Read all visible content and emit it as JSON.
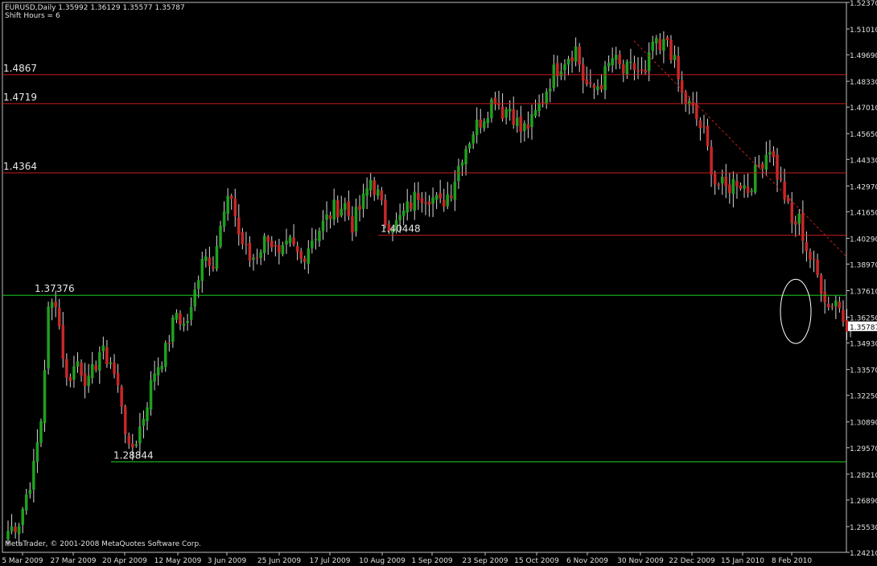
{
  "header": {
    "symbol_line": "EURUSD,Daily  1.35992 1.36129 1.35577 1.35787",
    "shift_line": "Shift Hours = 6"
  },
  "footer": {
    "copyright": "MetaTrader, © 2001-2008 MetaQuotes Software Corp."
  },
  "colors": {
    "background": "#000000",
    "bull": "#20a020",
    "bear": "#c82828",
    "resistance": "#c81e1e",
    "support": "#1ec81e",
    "trendline": "#c81e1e",
    "axis_text": "#e0e0e0",
    "current_price_bg": "#ffffff"
  },
  "chart_data": {
    "type": "candlestick",
    "symbol": "EURUSD",
    "timeframe": "Daily",
    "ylim": [
      1.2421,
      1.5237
    ],
    "y_ticks": [
      "1.52370",
      "1.51010",
      "1.49690",
      "1.48330",
      "1.47010",
      "1.45650",
      "1.44330",
      "1.42970",
      "1.41650",
      "1.40290",
      "1.38970",
      "1.37610",
      "1.36250",
      "1.34930",
      "1.33570",
      "1.32250",
      "1.30890",
      "1.29570",
      "1.28210",
      "1.26890",
      "1.25530",
      "1.24210"
    ],
    "x_ticks": [
      "5 Mar 2009",
      "27 Mar 2009",
      "20 Apr 2009",
      "12 May 2009",
      "3 Jun 2009",
      "25 Jun 2009",
      "17 Jul 2009",
      "10 Aug 2009",
      "1 Sep 2009",
      "23 Sep 2009",
      "15 Oct 2009",
      "6 Nov 2009",
      "30 Nov 2009",
      "22 Dec 2009",
      "15 Jan 2010",
      "8 Feb 2010"
    ],
    "current_price": "1.35787",
    "levels": [
      {
        "label": "1.4867",
        "price": 1.4867,
        "color": "red",
        "from": "5 Mar 2009"
      },
      {
        "label": "1.4719",
        "price": 1.4719,
        "color": "red",
        "from": "5 Mar 2009"
      },
      {
        "label": "1.4364",
        "price": 1.4364,
        "color": "red",
        "from": "5 Mar 2009"
      },
      {
        "label": "1.40448",
        "price": 1.40448,
        "color": "red",
        "from": "10 Aug 2009"
      },
      {
        "label": "1.37376",
        "price": 1.37376,
        "color": "green",
        "from": "5 Mar 2009"
      },
      {
        "label": "1.28844",
        "price": 1.28844,
        "color": "green",
        "from": "20 Apr 2009"
      }
    ],
    "trendline": {
      "from_date": "30 Nov 2009",
      "from_price": 1.504,
      "to_price": 1.3935,
      "style": "dashed"
    },
    "highlight": {
      "type": "ellipse",
      "date": "8 Feb 2010",
      "price_range": [
        1.354,
        1.377
      ]
    },
    "anchors": [
      {
        "i": 0,
        "p": 1.253
      },
      {
        "i": 3,
        "p": 1.258
      },
      {
        "i": 7,
        "p": 1.285
      },
      {
        "i": 9,
        "p": 1.31
      },
      {
        "i": 11,
        "p": 1.365
      },
      {
        "i": 13,
        "p": 1.372
      },
      {
        "i": 16,
        "p": 1.33
      },
      {
        "i": 19,
        "p": 1.34
      },
      {
        "i": 22,
        "p": 1.328
      },
      {
        "i": 25,
        "p": 1.345
      },
      {
        "i": 28,
        "p": 1.34
      },
      {
        "i": 31,
        "p": 1.319
      },
      {
        "i": 33,
        "p": 1.293
      },
      {
        "i": 35,
        "p": 1.3
      },
      {
        "i": 37,
        "p": 1.312
      },
      {
        "i": 40,
        "p": 1.335
      },
      {
        "i": 43,
        "p": 1.345
      },
      {
        "i": 46,
        "p": 1.365
      },
      {
        "i": 48,
        "p": 1.358
      },
      {
        "i": 50,
        "p": 1.365
      },
      {
        "i": 53,
        "p": 1.395
      },
      {
        "i": 56,
        "p": 1.392
      },
      {
        "i": 59,
        "p": 1.415
      },
      {
        "i": 61,
        "p": 1.425
      },
      {
        "i": 63,
        "p": 1.405
      },
      {
        "i": 66,
        "p": 1.392
      },
      {
        "i": 68,
        "p": 1.395
      },
      {
        "i": 71,
        "p": 1.405
      },
      {
        "i": 74,
        "p": 1.392
      },
      {
        "i": 77,
        "p": 1.4
      },
      {
        "i": 80,
        "p": 1.392
      },
      {
        "i": 83,
        "p": 1.403
      },
      {
        "i": 86,
        "p": 1.41
      },
      {
        "i": 89,
        "p": 1.418
      },
      {
        "i": 92,
        "p": 1.42
      },
      {
        "i": 94,
        "p": 1.41
      },
      {
        "i": 97,
        "p": 1.422
      },
      {
        "i": 99,
        "p": 1.433
      },
      {
        "i": 101,
        "p": 1.425
      },
      {
        "i": 103,
        "p": 1.412
      },
      {
        "i": 106,
        "p": 1.41
      },
      {
        "i": 109,
        "p": 1.418
      },
      {
        "i": 112,
        "p": 1.426
      },
      {
        "i": 115,
        "p": 1.425
      },
      {
        "i": 118,
        "p": 1.42
      },
      {
        "i": 121,
        "p": 1.428
      },
      {
        "i": 124,
        "p": 1.446
      },
      {
        "i": 127,
        "p": 1.458
      },
      {
        "i": 130,
        "p": 1.466
      },
      {
        "i": 133,
        "p": 1.476
      },
      {
        "i": 135,
        "p": 1.468
      },
      {
        "i": 137,
        "p": 1.47
      },
      {
        "i": 140,
        "p": 1.458
      },
      {
        "i": 143,
        "p": 1.462
      },
      {
        "i": 146,
        "p": 1.475
      },
      {
        "i": 149,
        "p": 1.488
      },
      {
        "i": 152,
        "p": 1.495
      },
      {
        "i": 155,
        "p": 1.5
      },
      {
        "i": 157,
        "p": 1.485
      },
      {
        "i": 159,
        "p": 1.478
      },
      {
        "i": 162,
        "p": 1.483
      },
      {
        "i": 165,
        "p": 1.495
      },
      {
        "i": 168,
        "p": 1.488
      },
      {
        "i": 171,
        "p": 1.49
      },
      {
        "i": 174,
        "p": 1.485
      },
      {
        "i": 176,
        "p": 1.503
      },
      {
        "i": 178,
        "p": 1.498
      },
      {
        "i": 180,
        "p": 1.505
      },
      {
        "i": 182,
        "p": 1.492
      },
      {
        "i": 184,
        "p": 1.476
      },
      {
        "i": 187,
        "p": 1.468
      },
      {
        "i": 190,
        "p": 1.456
      },
      {
        "i": 193,
        "p": 1.432
      },
      {
        "i": 196,
        "p": 1.428
      },
      {
        "i": 199,
        "p": 1.433
      },
      {
        "i": 202,
        "p": 1.428
      },
      {
        "i": 205,
        "p": 1.44
      },
      {
        "i": 208,
        "p": 1.45
      },
      {
        "i": 210,
        "p": 1.436
      },
      {
        "i": 212,
        "p": 1.425
      },
      {
        "i": 214,
        "p": 1.41
      },
      {
        "i": 216,
        "p": 1.412
      },
      {
        "i": 218,
        "p": 1.398
      },
      {
        "i": 220,
        "p": 1.388
      },
      {
        "i": 222,
        "p": 1.379
      },
      {
        "i": 224,
        "p": 1.368
      },
      {
        "i": 226,
        "p": 1.372
      },
      {
        "i": 228,
        "p": 1.362
      },
      {
        "i": 230,
        "p": 1.3579
      }
    ]
  }
}
